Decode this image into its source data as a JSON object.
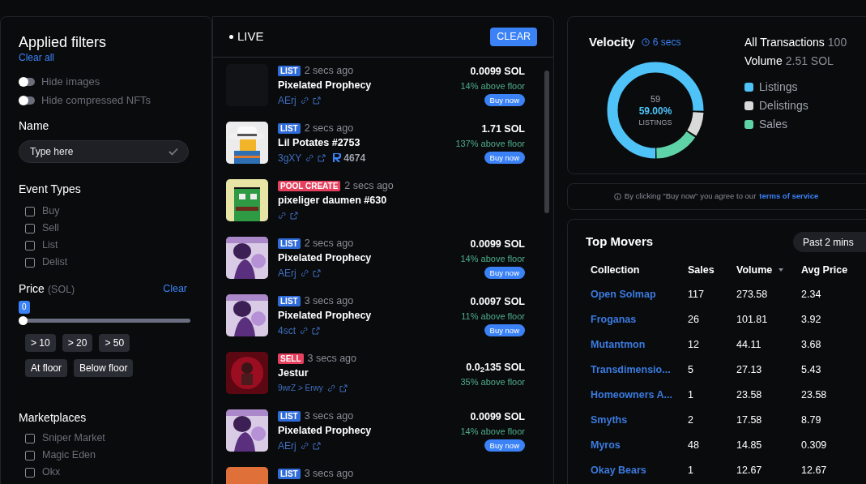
{
  "filters": {
    "title": "Applied filters",
    "clear_all": "Clear all",
    "toggles": [
      {
        "label": "Hide images",
        "on": false
      },
      {
        "label": "Hide compressed NFTs",
        "on": false
      }
    ],
    "name": {
      "title": "Name",
      "placeholder": "Type here"
    },
    "event_types": {
      "title": "Event Types",
      "options": [
        {
          "label": "Buy",
          "checked": false
        },
        {
          "label": "Sell",
          "checked": false
        },
        {
          "label": "List",
          "checked": false
        },
        {
          "label": "Delist",
          "checked": false
        }
      ]
    },
    "price": {
      "title": "Price",
      "unit": "(SOL)",
      "clear": "Clear",
      "value": "0",
      "level": 0,
      "quick": [
        "> 10",
        "> 20",
        "> 50"
      ],
      "floor": [
        "At floor",
        "Below floor"
      ]
    },
    "marketplaces": {
      "title": "Marketplaces",
      "options": [
        {
          "label": "Sniper Market",
          "checked": false
        },
        {
          "label": "Magic Eden",
          "checked": false
        },
        {
          "label": "Okx",
          "checked": false
        }
      ]
    }
  },
  "feed": {
    "title": "LIVE",
    "clear": "CLEAR",
    "items": [
      {
        "kind": "blank",
        "tag": "LIST",
        "color": "#2f6bd9",
        "time": "2 secs ago",
        "name": "Pixelated Prophecy",
        "account": "AErj",
        "price": "0.0099 SOL",
        "floor": "14% above floor",
        "action": "Buy now"
      },
      {
        "kind": "hat",
        "tag": "LIST",
        "color": "#2f6bd9",
        "time": "2 secs ago",
        "name": "Lil Potates #2753",
        "account": "3gXY",
        "rank": "4674",
        "price": "1.71 SOL",
        "floor": "137% above floor",
        "action": "Buy now"
      },
      {
        "kind": "frog",
        "tag": "POOL CREATE",
        "color": "#e5405e",
        "time": "2 secs ago",
        "name": "pixeliger daumen #630"
      },
      {
        "kind": "figure",
        "tag": "LIST",
        "color": "#2f6bd9",
        "time": "2 secs ago",
        "name": "Pixelated Prophecy",
        "account": "AErj",
        "price": "0.0099 SOL",
        "floor": "14% above floor",
        "action": "Buy now"
      },
      {
        "kind": "figure",
        "tag": "LIST",
        "color": "#2f6bd9",
        "time": "3 secs ago",
        "name": "Pixelated Prophecy",
        "account": "4sct",
        "price": "0.0097 SOL",
        "floor": "11% above floor",
        "action": "Buy now"
      },
      {
        "kind": "red",
        "tag": "SELL",
        "color": "#e5405e",
        "time": "3 secs ago",
        "name": "Jestur",
        "account": "9wrZ > Erwy",
        "price": "0.0$_{2}$135 SOL",
        "floor": "35% above floor"
      },
      {
        "kind": "figure",
        "tag": "LIST",
        "color": "#2f6bd9",
        "time": "3 secs ago",
        "name": "Pixelated Prophecy",
        "account": "AErj",
        "price": "0.0099 SOL",
        "floor": "14% above floor",
        "action": "Buy now"
      },
      {
        "kind": "orange",
        "tag": "LIST",
        "color": "#2f6bd9",
        "time": "3 secs ago"
      }
    ]
  },
  "velocity": {
    "title": "Velocity",
    "interval": "6 secs",
    "center_count": "59",
    "center_percent": "59.00%",
    "center_label": "LISTINGS",
    "transactions_label": "All Transactions",
    "transactions": "100",
    "volume_label": "Volume",
    "volume": "2.51 SOL",
    "legend": [
      {
        "label": "Listings",
        "color": "#4fc3f7"
      },
      {
        "label": "Delistings",
        "color": "#d9d9d9"
      },
      {
        "label": "Sales",
        "color": "#5fd3a8"
      }
    ]
  },
  "notice": {
    "text": "By clicking \"Buy now\" you agree to our",
    "link": "terms of service"
  },
  "top_movers": {
    "title": "Top Movers",
    "period": "Past 2 mins",
    "columns": [
      {
        "label": "Collection",
        "sorted": false
      },
      {
        "label": "Sales",
        "sorted": false
      },
      {
        "label": "Volume",
        "sorted": true
      },
      {
        "label": "Avg Price",
        "sorted": false
      }
    ],
    "rows": [
      [
        "Open Solmap",
        "117",
        "273.58",
        "2.34"
      ],
      [
        "Froganas",
        "26",
        "101.81",
        "3.92"
      ],
      [
        "Mutantmon",
        "12",
        "44.11",
        "3.68"
      ],
      [
        "Transdimensio...",
        "5",
        "27.13",
        "5.43"
      ],
      [
        "Homeowners A...",
        "1",
        "23.58",
        "23.58"
      ],
      [
        "Smyths",
        "2",
        "17.58",
        "8.79"
      ],
      [
        "Myros",
        "48",
        "14.85",
        "0.309"
      ],
      [
        "Okay Bears",
        "1",
        "12.67",
        "12.67"
      ]
    ]
  }
}
